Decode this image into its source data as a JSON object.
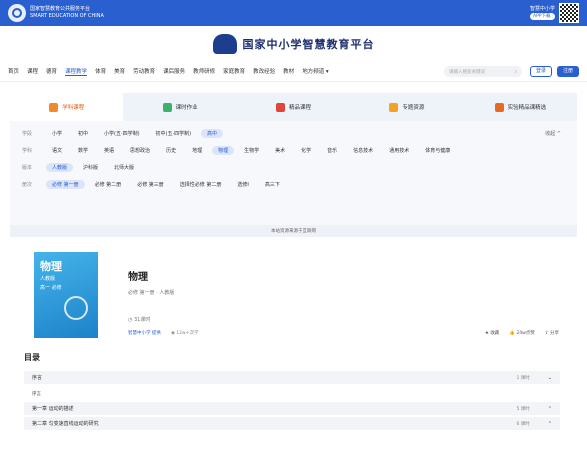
{
  "topbar": {
    "org_line1": "国家智慧教育公共服务平台",
    "org_line2": "SMART EDUCATION OF CHINA",
    "app_label": "智慧中小学",
    "app_button": "APP下载"
  },
  "brand": {
    "title": "国家中小学智慧教育平台"
  },
  "nav": {
    "items": [
      "首页",
      "课程",
      "德育",
      "课程教学",
      "体育",
      "美育",
      "劳动教育",
      "课后服务",
      "教师研修",
      "家庭教育",
      "教改经验",
      "教材",
      "地方频道 ▾"
    ],
    "active_index": 3,
    "search_placeholder": "请输入搜索关键词",
    "login": "登录",
    "register": "注册"
  },
  "category_tabs": [
    {
      "label": "学科课程",
      "color": "#f08a2a"
    },
    {
      "label": "课时作业",
      "color": "#39b36b"
    },
    {
      "label": "精品课程",
      "color": "#e0453c"
    },
    {
      "label": "专题资源",
      "color": "#f2a227"
    },
    {
      "label": "实验精品课精选",
      "color": "#e86a22"
    }
  ],
  "filters": {
    "collapse_label": "收起 ^",
    "rows": [
      {
        "label": "学段",
        "items": [
          "小学",
          "初中",
          "小学(五·四学制)",
          "初中(五·四学制)",
          "高中"
        ],
        "selected": 4
      },
      {
        "label": "学科",
        "items": [
          "语文",
          "数学",
          "英语",
          "思想政治",
          "历史",
          "地理",
          "物理",
          "生物学",
          "美术",
          "化学",
          "音乐",
          "信息技术",
          "通用技术",
          "体育与健康"
        ],
        "selected": 6
      },
      {
        "label": "版本",
        "items": [
          "人教版",
          "沪科版",
          "北师大版"
        ],
        "selected": 0
      },
      {
        "label": "册次",
        "items": [
          "必修 第一册",
          "必修 第二册",
          "必修 第三册",
          "选择性必修 第二册",
          "选修I",
          "高三下"
        ],
        "selected": 0
      }
    ]
  },
  "notice": "本站资源来源于互联网",
  "book": {
    "cover_title": "物理",
    "cover_line1": "人教版",
    "cover_line2": "高一 必修",
    "title": "物理",
    "subtitle": "必修 第一册 · 人教版",
    "hours": "31课时",
    "source": "智慧中小学 提供",
    "views": "12w+次学",
    "favorite": "收藏",
    "likes": "24w点赞",
    "share": "分享"
  },
  "toc": {
    "title": "目录",
    "rows": [
      {
        "label": "序言",
        "meta": "1 课时",
        "expanded": true,
        "children": [
          "序言"
        ]
      },
      {
        "label": "第一章 运动的描述",
        "meta": "5 课时",
        "expanded": false,
        "children": []
      },
      {
        "label": "第二章 匀变速直线运动的研究",
        "meta": "6 课时",
        "expanded": false,
        "children": []
      }
    ]
  }
}
